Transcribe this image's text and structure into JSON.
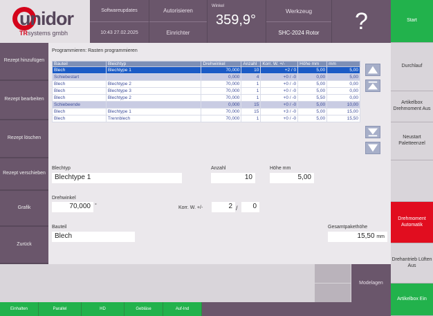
{
  "logo": {
    "brand": "unidor",
    "sub_red": "TR",
    "sub_rest": "systems gmbh"
  },
  "header": {
    "software": "Softwareupdates",
    "datetime": "10:43 27.02.2025",
    "user_title": "Autorisieren",
    "user_role": "Einrichter",
    "winkel_label": "Winkel",
    "winkel_value": "359,9°",
    "werkzeug_label": "Werkzeug",
    "werkzeug_value": "SHC-2024 Rotor",
    "help": "?"
  },
  "sidebar": [
    {
      "label": "Rezept hinzufügen"
    },
    {
      "label": "Rezept bearbeiten"
    },
    {
      "label": "Rezept löschen"
    },
    {
      "label": "Rezept verschieben"
    },
    {
      "label": "Grafik"
    },
    {
      "label": "Zurück"
    }
  ],
  "right_panel": [
    {
      "label": "Start"
    },
    {
      "label": "Durchlauf"
    },
    {
      "label": "Artikelbox Drehmoment Aus"
    },
    {
      "label": "Neustart Paletteenzel"
    },
    {
      "label": ""
    },
    {
      "label": "Drehmoment Automatik"
    },
    {
      "label": "Drehantrieb Lüften Aus"
    },
    {
      "label": "Artikelbox Ein"
    }
  ],
  "main": {
    "title": "Programmieren: Rasten programmieren",
    "columns": [
      "Bauteil",
      "Bleichtyp",
      "Drehwinkel",
      "Anzahl",
      "Korr. W. +/-",
      "Höhe mm",
      "mm"
    ],
    "rows": [
      {
        "type": "sel",
        "cells": [
          "Blech",
          "Blechtype 1",
          "70,000",
          "10",
          "+2 / 0",
          "5,00",
          "5,00"
        ]
      },
      {
        "type": "grp",
        "cells": [
          "Schiebestart",
          "",
          "0,000",
          "4",
          "+0 / -0",
          "0,00",
          "5,00"
        ]
      },
      {
        "type": "row",
        "cells": [
          "Blech",
          "Blechtype 2",
          "70,000",
          "1",
          "+0 / -0",
          "5,00",
          "0,00"
        ]
      },
      {
        "type": "row",
        "cells": [
          "Blech",
          "Blechtype 3",
          "70,000",
          "1",
          "+0 / -0",
          "5,00",
          "0,00"
        ]
      },
      {
        "type": "row",
        "cells": [
          "Blech",
          "Blechtype 2",
          "70,000",
          "1",
          "+0 / -0",
          "5,50",
          "0,00"
        ]
      },
      {
        "type": "grp",
        "cells": [
          "Schiebeende",
          "",
          "0,000",
          "15",
          "+0 / -0",
          "5,00",
          "10,00"
        ]
      },
      {
        "type": "row",
        "cells": [
          "Blech",
          "Blechtype 1",
          "70,000",
          "15",
          "+3 / -0",
          "5,00",
          "15,00"
        ]
      },
      {
        "type": "row",
        "cells": [
          "Blech",
          "Trennblech",
          "70,000",
          "1",
          "+0 / -0",
          "5,00",
          "15,50"
        ]
      }
    ],
    "blechtyp_label": "Blechtyp",
    "blechtyp_value": "Blechtype 1",
    "anzahl_label": "Anzahl",
    "anzahl_value": "10",
    "hoehe_label": "Höhe mm",
    "hoehe_value": "5,00",
    "drehwinkel_label": "Drehwinkel",
    "drehwinkel_value": "70,000",
    "drehwinkel_unit": "°",
    "korr_label": "Korr. W. +/-",
    "korr_a": "2",
    "korr_sep": "/",
    "korr_b": "0",
    "bauteil_label": "Bauteil",
    "bauteil_value": "Blech",
    "gesamt_label": "Gesamtpakethöhe",
    "gesamt_value": "15,50",
    "gesamt_unit": "mm"
  },
  "bottom": {
    "btn1": "",
    "btn2": "",
    "modelagen": "Modelagen"
  },
  "fkeys": [
    "Einhalten",
    "Parallel",
    "HD",
    "Gebläse",
    "Auf-Ind"
  ]
}
